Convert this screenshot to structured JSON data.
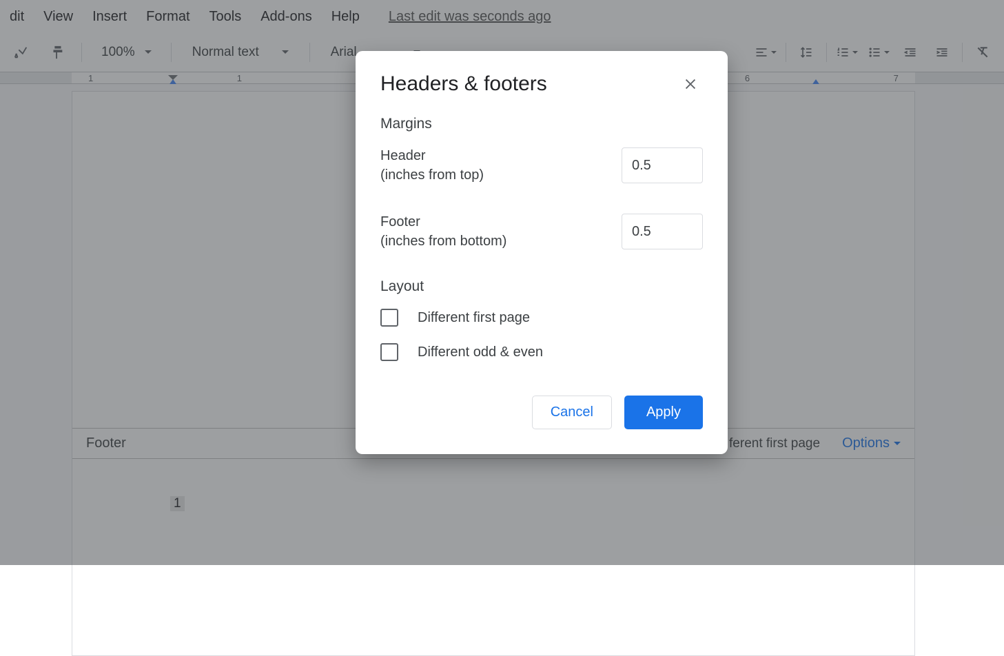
{
  "menubar": {
    "items": [
      "dit",
      "View",
      "Insert",
      "Format",
      "Tools",
      "Add-ons",
      "Help"
    ],
    "last_edit": "Last edit was seconds ago"
  },
  "toolbar": {
    "zoom": "100%",
    "style": "Normal text",
    "font": "Arial"
  },
  "ruler": {
    "ticks": [
      "1",
      "",
      "1",
      "",
      "",
      "",
      "",
      "",
      "",
      "6",
      "",
      "7"
    ]
  },
  "footer": {
    "label": "Footer",
    "different_first_page": "ferent first page",
    "options": "Options",
    "page_number": "1"
  },
  "dialog": {
    "title": "Headers & footers",
    "margins_section": "Margins",
    "header_label_line1": "Header",
    "header_label_line2": "(inches from top)",
    "header_value": "0.5",
    "footer_label_line1": "Footer",
    "footer_label_line2": "(inches from bottom)",
    "footer_value": "0.5",
    "layout_section": "Layout",
    "different_first_page": "Different first page",
    "different_odd_even": "Different odd & even",
    "cancel": "Cancel",
    "apply": "Apply"
  }
}
